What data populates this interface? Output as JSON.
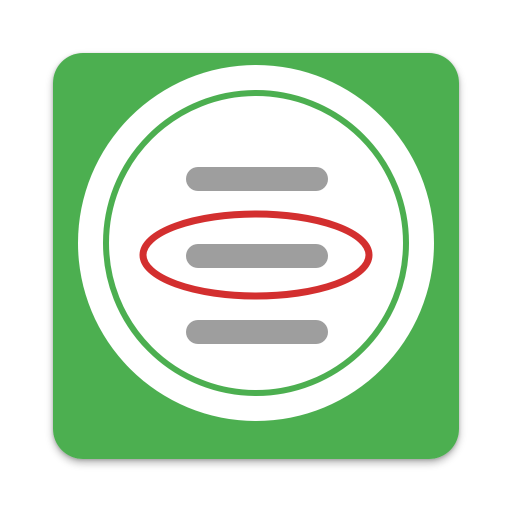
{
  "icon": {
    "name": "list-highlight-app-icon",
    "colors": {
      "background": "#4caf50",
      "outer_ring": "#ffffff",
      "inner_ring": "#4caf50",
      "inner_disc": "#ffffff",
      "line": "#9e9e9e",
      "highlight_ellipse": "#d32f2f"
    },
    "list_lines": [
      {
        "label": "line-1",
        "highlighted": false
      },
      {
        "label": "line-2",
        "highlighted": true
      },
      {
        "label": "line-3",
        "highlighted": false
      }
    ]
  }
}
